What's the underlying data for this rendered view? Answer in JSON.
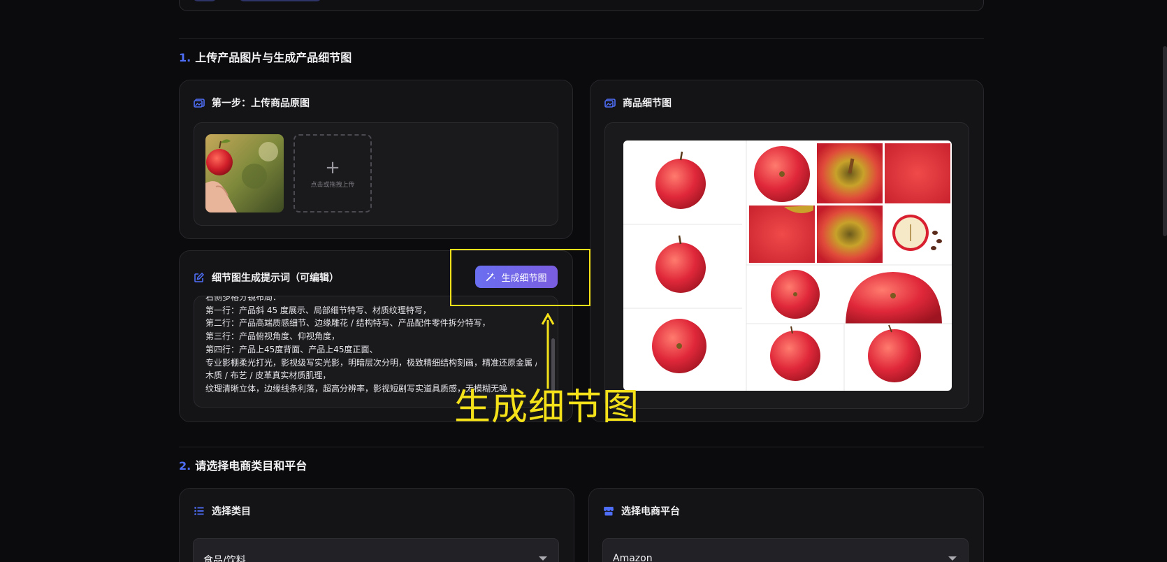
{
  "section1": {
    "number": "1.",
    "title": "上传产品图片与生成产品细节图"
  },
  "upload_card": {
    "title": "第一步：上传商品原图",
    "upload_hint": "点击或拖拽上传",
    "plus": "+"
  },
  "detail_card": {
    "title": "商品细节图"
  },
  "prompt_card": {
    "title": "细节图生成提示词（可编辑）",
    "button_label": "生成细节图",
    "lines": [
      "右侧多格分镜布局：",
      "第一行：产品斜 45 度展示、局部细节特写、材质纹理特写，",
      "第二行：产品高端质感细节、边缘雕花 / 结构特写、产品配件零件拆分特写，",
      "第三行：产品俯视角度、仰视角度，",
      "第四行：产品上45度背面、产品上45度正面、",
      "专业影棚柔光打光，影视级写实光影，明暗层次分明，极致精细结构刻画，精准还原金属 /",
      "木质 / 布艺 / 皮革真实材质肌理，",
      "纹理清晰立体，边缘线条利落，超高分辨率，影视短剧写实道具质感，无模糊无噪"
    ]
  },
  "annotation": {
    "label": "生成细节图"
  },
  "section2": {
    "number": "2.",
    "title": "请选择电商类目和平台"
  },
  "category_card": {
    "title": "选择类目",
    "selected": "食品/饮料"
  },
  "platform_card": {
    "title": "选择电商平台",
    "selected": "Amazon"
  },
  "colors": {
    "accent": "#4f6ef7",
    "annotation": "#f4e11a",
    "button_start": "#6a6ff0",
    "button_end": "#7b5de0"
  }
}
